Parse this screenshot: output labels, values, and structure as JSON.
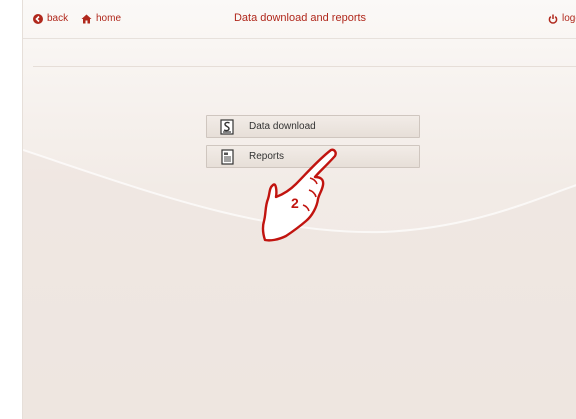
{
  "header": {
    "back_label": "back",
    "home_label": "home",
    "title": "Data download and reports",
    "logout_label": "logo"
  },
  "menu": {
    "items": [
      {
        "label": "Data download",
        "icon": "data-download-icon"
      },
      {
        "label": "Reports",
        "icon": "reports-icon"
      }
    ]
  },
  "annotation": {
    "step_number": "2"
  },
  "colors": {
    "accent": "#b0281c",
    "background": "#f3ede8"
  }
}
